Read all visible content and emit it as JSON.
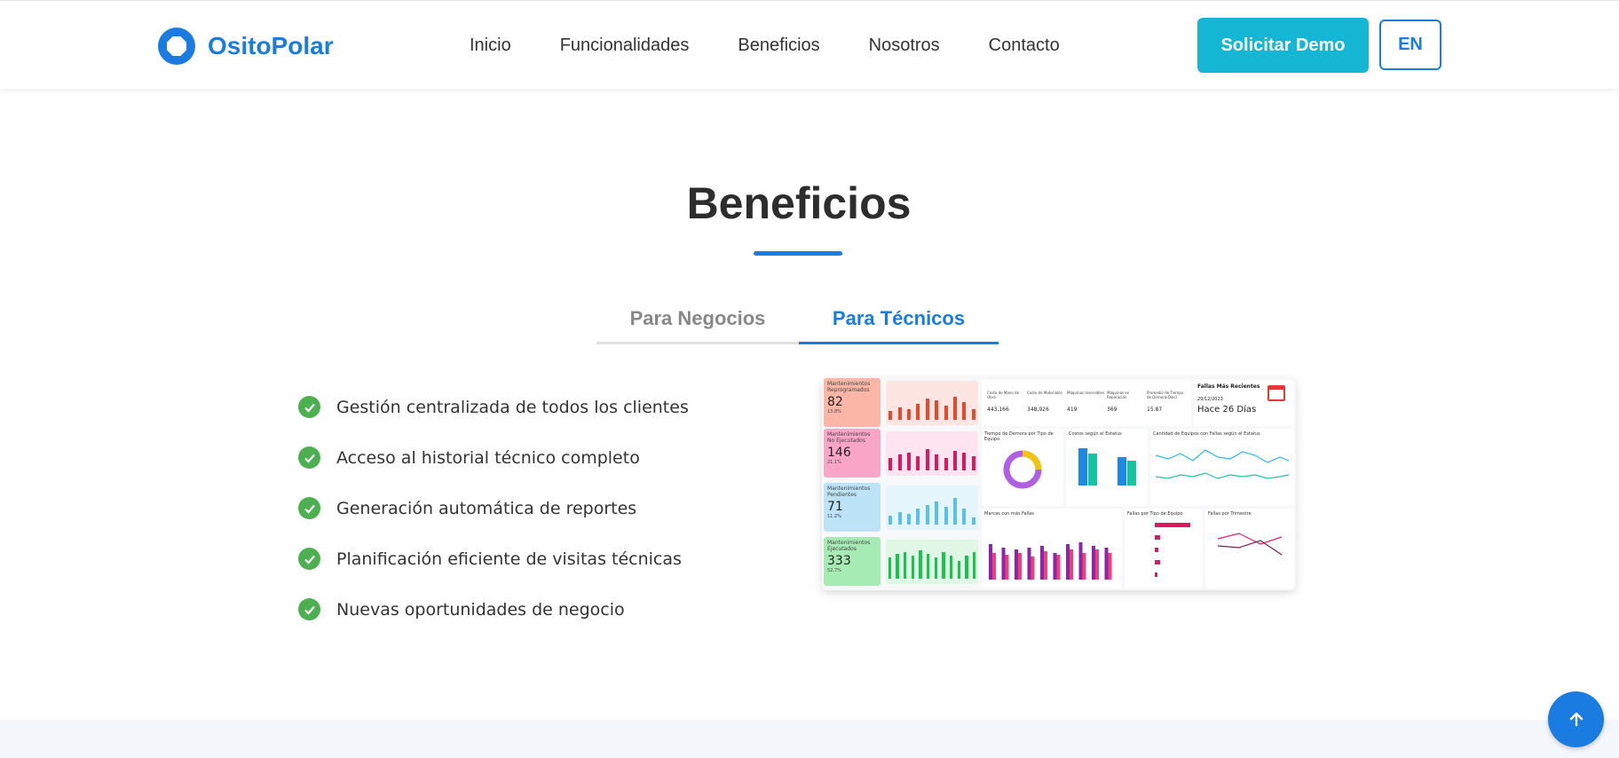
{
  "brand": {
    "name": "OsitoPolar",
    "color": "#1a7ce0"
  },
  "nav": {
    "items": [
      "Inicio",
      "Funcionalidades",
      "Beneficios",
      "Nosotros",
      "Contacto"
    ],
    "demo_label": "Solicitar Demo",
    "lang_label": "EN"
  },
  "section": {
    "title": "Beneficios",
    "tabs": [
      {
        "label": "Para Negocios",
        "active": false
      },
      {
        "label": "Para Técnicos",
        "active": true
      }
    ],
    "benefits": [
      "Gestión centralizada de todos los clientes",
      "Acceso al historial técnico completo",
      "Generación automática de reportes",
      "Planificación eficiente de visitas técnicas",
      "Nuevas oportunidades de negocio"
    ]
  },
  "dashboard": {
    "kpis": [
      {
        "label": "Mantenimientos Reprogramados",
        "value": "82",
        "pct": "13.8%",
        "color": "#fbb6a8",
        "bar": "#e64a2e",
        "bg": "#fde6e1"
      },
      {
        "label": "Mantenimientos No Ejecutados",
        "value": "146",
        "pct": "21.1%",
        "color": "#f8a5c8",
        "bar": "#d81b60",
        "bg": "#fde4ee"
      },
      {
        "label": "Mantenimientos Pendientes",
        "value": "71",
        "pct": "11.2%",
        "color": "#bde3f7",
        "bar": "#5bc0e6",
        "bg": "#e5f5fc"
      },
      {
        "label": "Mantenimientos Ejecutados",
        "value": "333",
        "pct": "52.7%",
        "color": "#a7ebb4",
        "bar": "#18c44b",
        "bg": "#dff7e4"
      }
    ],
    "stats": [
      {
        "label": "Costo de Mano de Obra",
        "value": "443,166"
      },
      {
        "label": "Costo de Materiales",
        "value": "348,926"
      },
      {
        "label": "Máquinas Inservibles",
        "value": "419"
      },
      {
        "label": "Máquinas en Reparación",
        "value": "369"
      },
      {
        "label": "Promedio de Tiempo de Demora(Días)",
        "value": "15.87"
      }
    ],
    "recent": {
      "title": "Fallas Más Recientes",
      "date": "29/12/2023",
      "text": "Hace 26 Días"
    },
    "panels": {
      "donut_title": "Tiempo de Demora por Tipo de Equipo",
      "costs_title": "Costos según el Estatus",
      "line_title": "Cantidad de Equipos con Fallas según el Estatus",
      "brand_title": "Marcas con más Fallas",
      "type_title": "Fallas por Tipo de Equipo",
      "quarter_title": "Fallas por Trimestre"
    }
  },
  "scroll_top_icon": "arrow-up-icon"
}
